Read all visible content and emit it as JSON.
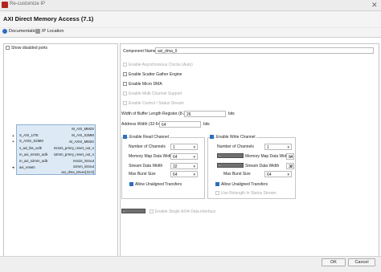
{
  "window": {
    "title": "Re-customize IP",
    "header": "AXI Direct Memory Access (7.1)"
  },
  "tabs": [
    "Documentation",
    "IP Location"
  ],
  "left": {
    "show_disabled_ports": "Show disabled ports",
    "pins_left": [
      "S_AXI_LITE",
      "S_AXIS_S2MM",
      "s_axi_lite_aclk",
      "m_axi_mm2s_aclk",
      "m_axi_s2mm_aclk",
      "axi_resetn"
    ],
    "pins_right": [
      "M_AXI_MM2S",
      "M_AXI_S2MM",
      "M_AXIS_MM2S",
      "mm2s_prmry_reset_out_n",
      "s2mm_prmry_reset_out_n",
      "mm2s_introut",
      "s2mm_introut",
      "axi_dma_tstvec[31:0]"
    ]
  },
  "right": {
    "component_name_label": "Component Name",
    "component_name_value": "axi_dma_0",
    "opt_async": "Enable Asynchronous Clocks (Auto)",
    "opt_sg": "Enable Scatter Gather Engine",
    "opt_micro": "Enable Micro DMA",
    "opt_multi": "Enable Multi Channel Support",
    "opt_control": "Enable Control / Status Stream",
    "buffer_label": "Width of Buffer Length Register (8-26)",
    "buffer_value": "26",
    "buffer_unit": "bits",
    "addr_label": "Address Width (32-64)",
    "addr_value": "64",
    "addr_unit": "bits",
    "read": {
      "title": "Enable Read Channel",
      "channels_label": "Number of Channels",
      "channels_value": "1",
      "mm_width_label": "Memory Map Data Width",
      "mm_width_value": "64",
      "stream_width_label": "Stream Data Width",
      "stream_width_value": "32",
      "burst_label": "Max Burst Size",
      "burst_value": "64",
      "unaligned": "Allow Unaligned Transfers"
    },
    "write": {
      "title": "Enable Write Channel",
      "channels_label": "Number of Channels",
      "channels_value": "1",
      "mm_width_label": "Memory Map Data Width",
      "mm_width_value": "64",
      "stream_width_label": "Stream Data Width",
      "stream_width_value": "32",
      "burst_label": "Max Burst Size",
      "burst_value": "64",
      "unaligned": "Allow Unaligned Transfers",
      "rxlength": "Use Rxlength In Status Stream"
    },
    "single_interface": "Enable Single AXI4 Data interface"
  },
  "footer": {
    "ok": "OK",
    "cancel": "Cancel"
  }
}
